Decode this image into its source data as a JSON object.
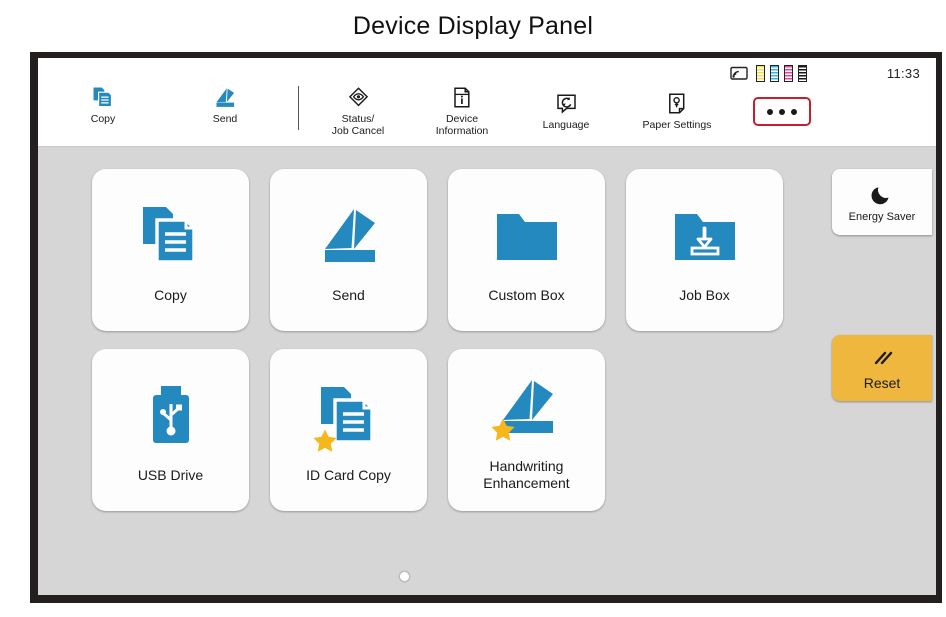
{
  "page": {
    "title": "Device Display Panel"
  },
  "status_bar": {
    "time": "11:33",
    "icons": [
      {
        "name": "wireless-cast-icon"
      }
    ],
    "toner_levels": [
      {
        "name": "toner-yellow",
        "color": "#f5e14b",
        "label": "Yellow"
      },
      {
        "name": "toner-cyan",
        "color": "#35b6e8",
        "label": "Cyan"
      },
      {
        "name": "toner-magenta",
        "color": "#e8459a",
        "label": "Magenta"
      },
      {
        "name": "toner-black",
        "color": "#1a1a1a",
        "label": "Black"
      }
    ]
  },
  "toolbar": {
    "left_items": [
      {
        "label": "Copy",
        "icon": "copy-icon"
      },
      {
        "label": "Send",
        "icon": "send-icon"
      }
    ],
    "right_items": [
      {
        "label": "Status/\nJob Cancel",
        "icon": "status-job-cancel-icon"
      },
      {
        "label": "Device\nInformation",
        "icon": "device-information-icon"
      },
      {
        "label": "Language",
        "icon": "language-icon"
      },
      {
        "label": "Paper Settings",
        "icon": "paper-settings-icon"
      }
    ],
    "more_button": {
      "name": "more-options-button",
      "highlight_color": "#c31f2e"
    }
  },
  "home": {
    "tiles": [
      {
        "label": "Copy",
        "icon": "copy-icon",
        "starred": false
      },
      {
        "label": "Send",
        "icon": "send-icon",
        "starred": false
      },
      {
        "label": "Custom Box",
        "icon": "folder-icon",
        "starred": false
      },
      {
        "label": "Job Box",
        "icon": "job-box-icon",
        "starred": false
      },
      {
        "label": "USB Drive",
        "icon": "usb-drive-icon",
        "starred": false
      },
      {
        "label": "ID Card Copy",
        "icon": "copy-icon",
        "starred": true
      },
      {
        "label": "Handwriting\nEnhancement",
        "icon": "send-icon",
        "starred": true
      }
    ],
    "page_indicator": {
      "pages": 1,
      "current": 1
    }
  },
  "side_buttons": {
    "energy_saver": {
      "label": "Energy Saver",
      "icon": "moon-icon",
      "color": "#fdfdfd"
    },
    "reset": {
      "label": "Reset",
      "icon": "reset-slash-icon",
      "color": "#f0b73f"
    }
  },
  "colors": {
    "accent_blue": "#2389be",
    "star_gold": "#f5b71b",
    "highlight_red": "#c31f2e",
    "screen_bg": "#d6d6d6",
    "bezel": "#231f1e"
  }
}
